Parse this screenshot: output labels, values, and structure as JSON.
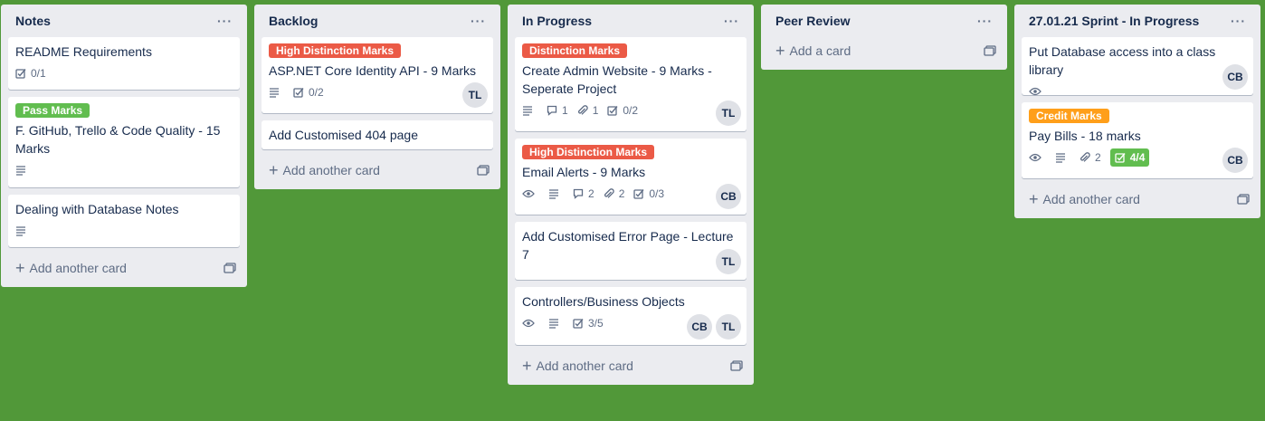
{
  "colors": {
    "background": "#519839",
    "label_red": "#eb5a46",
    "label_green": "#61bd4f",
    "label_orange": "#ff9f1a",
    "badge_done": "#61bd4f"
  },
  "lists": [
    {
      "title": "Notes",
      "menu": "···",
      "add_label": "Add another card",
      "cards": [
        {
          "label": "",
          "title": "README Requirements",
          "checklist": "0/1"
        },
        {
          "label": "Pass Marks",
          "title": "F. GitHub, Trello & Code Quality - 15 Marks"
        },
        {
          "label": "",
          "title": "Dealing with Database Notes"
        }
      ]
    },
    {
      "title": "Backlog",
      "menu": "···",
      "add_label": "Add another card",
      "cards": [
        {
          "label": "High Distinction Marks",
          "title": "ASP.NET Core Identity API - 9 Marks",
          "checklist": "0/2",
          "members": [
            "TL"
          ]
        },
        {
          "title": "Add Customised 404 page"
        }
      ]
    },
    {
      "title": "In Progress",
      "menu": "···",
      "add_label": "Add another card",
      "cards": [
        {
          "label": "Distinction Marks",
          "title": "Create Admin Website - 9 Marks - Seperate Project",
          "comments": "1",
          "attachments": "1",
          "checklist": "0/2",
          "members": [
            "TL"
          ]
        },
        {
          "label": "High Distinction Marks",
          "title": "Email Alerts - 9 Marks",
          "comments": "2",
          "attachments": "2",
          "checklist": "0/3",
          "members": [
            "CB"
          ]
        },
        {
          "title": "Add Customised Error Page - Lecture 7",
          "members": [
            "TL"
          ]
        },
        {
          "title": "Controllers/Business Objects",
          "checklist": "3/5",
          "members": [
            "CB",
            "TL"
          ]
        }
      ]
    },
    {
      "title": "Peer Review",
      "menu": "···",
      "add_label": "Add a card"
    },
    {
      "title": "27.01.21 Sprint - In Progress",
      "menu": "···",
      "add_label": "Add another card",
      "cards": [
        {
          "title": "Put Database access into a class library",
          "members": [
            "CB"
          ]
        },
        {
          "label": "Credit Marks",
          "title": "Pay Bills - 18 marks",
          "attachments": "2",
          "checklist": "4/4",
          "members": [
            "CB"
          ]
        }
      ]
    }
  ]
}
